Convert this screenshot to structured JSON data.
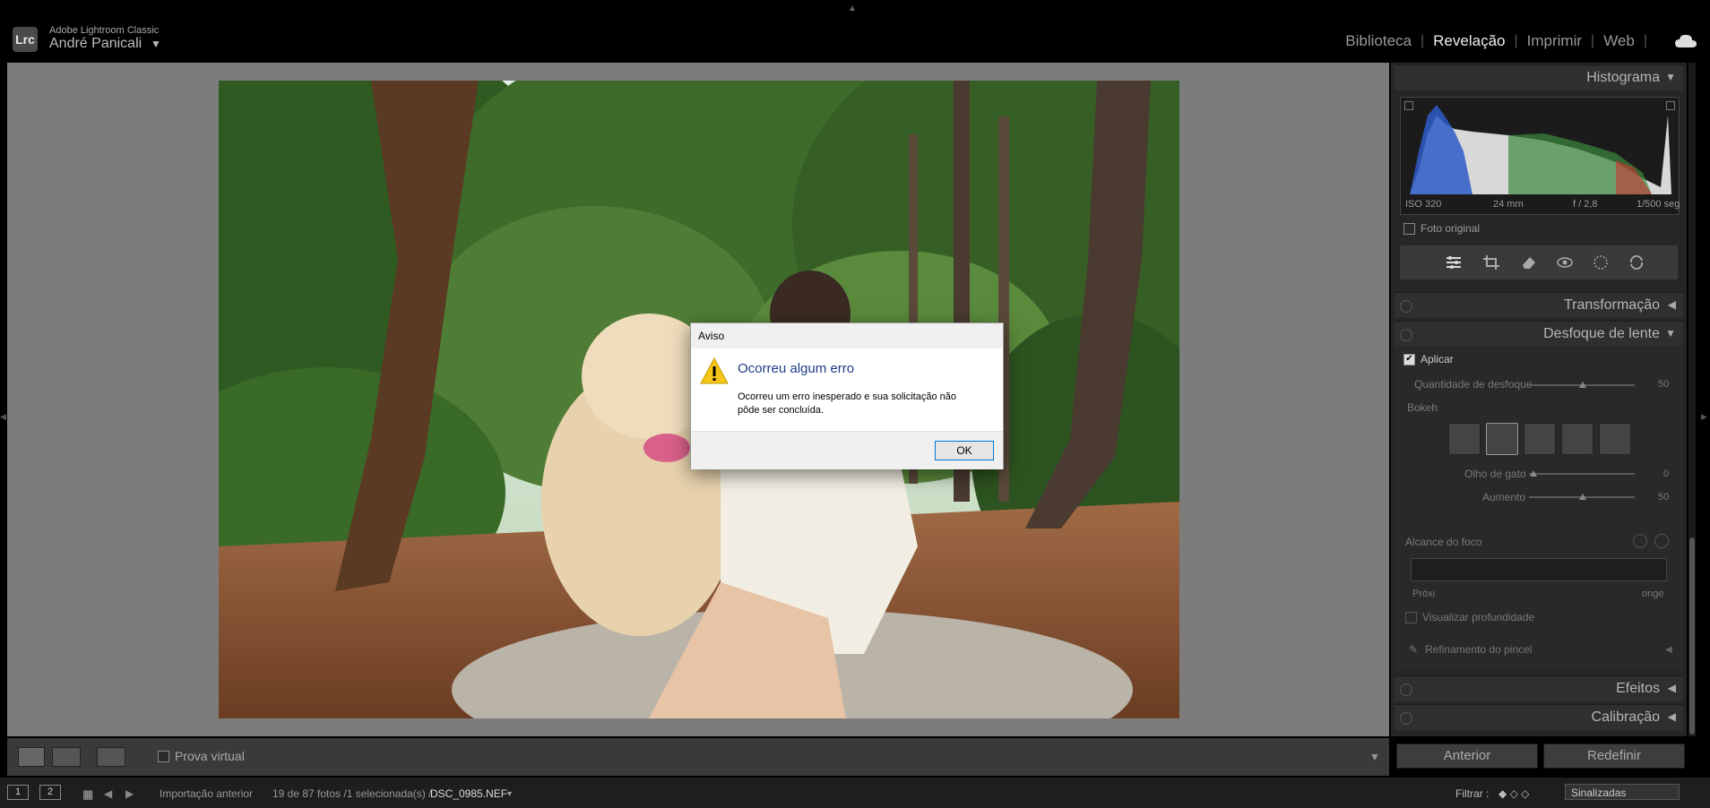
{
  "app": {
    "logo": "Lrc",
    "title": "Adobe Lightroom Classic",
    "user": "André Panicali",
    "user_arrow": "▼"
  },
  "modules": [
    {
      "label": "Biblioteca",
      "active": false
    },
    {
      "label": "Revelação",
      "active": true
    },
    {
      "label": "Imprimir",
      "active": false
    },
    {
      "label": "Web",
      "active": false
    }
  ],
  "toolbar": {
    "prova_virtual": "Prova virtual",
    "dropdown": "▼"
  },
  "filmstrip": {
    "screen1": "1",
    "screen2": "2",
    "source": "Importação anterior",
    "count": "19 de 87 fotos /1 selecionada(s) /",
    "filename": "DSC_0985.NEF",
    "filename_arrow": "▼",
    "filter_label": "Filtrar :",
    "filter_value": "Sinalizadas"
  },
  "panels": {
    "histogram": {
      "title": "Histograma",
      "iso": "ISO 320",
      "focal": "24 mm",
      "aperture": "f / 2,8",
      "shutter": "1/500 seg",
      "original": "Foto original"
    },
    "transform": {
      "title": "Transformação"
    },
    "lens_blur": {
      "title": "Desfoque de lente",
      "apply": "Aplicar",
      "amount_label": "Quantidade de desfoque",
      "amount_value": "50",
      "bokeh_label": "Bokeh",
      "cateye_label": "Olho de gato",
      "cateye_value": "0",
      "boost_label": "Aumento",
      "boost_value": "50",
      "focus_label": "Alcance do foco",
      "near": "Próxi",
      "far": "onge",
      "visualize": "Visualizar profundidade",
      "brush": "Refinamento do pincel"
    },
    "effects": {
      "title": "Efeitos"
    },
    "calibration": {
      "title": "Calibração"
    }
  },
  "buttons": {
    "previous": "Anterior",
    "reset": "Redefinir"
  },
  "dialog": {
    "window_title": "Aviso",
    "heading": "Ocorreu algum erro",
    "message": "Ocorreu um erro inesperado e sua solicitação não pôde ser concluída.",
    "ok": "OK"
  },
  "colors": {
    "accent_blue": "#1f3c88",
    "warning_yellow": "#f5c518"
  }
}
